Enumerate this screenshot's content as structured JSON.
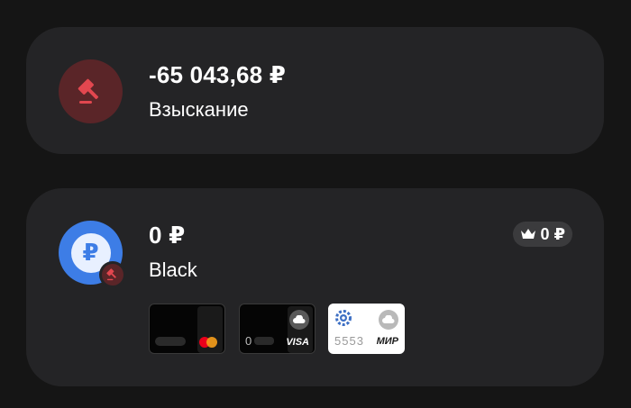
{
  "debt_card": {
    "amount": "-65 043,68 ₽",
    "label": "Взыскание",
    "icon": "gavel-icon",
    "icon_bg": "#5a2528",
    "icon_color": "#e2474f"
  },
  "account_card": {
    "amount": "0 ₽",
    "label": "Black",
    "icon": "ruble-icon",
    "icon_symbol": "₽",
    "icon_bg": "#3d7de6",
    "badge_icon": "gavel-icon",
    "bonus": {
      "icon": "crown-icon",
      "value": "0 ₽"
    },
    "cards": [
      {
        "name": "mastercard-card",
        "number": "",
        "brand": "mastercard-logo",
        "theme": "black"
      },
      {
        "name": "visa-card",
        "number": "0",
        "brand": "VISA",
        "theme": "black",
        "badge": "cloud-icon"
      },
      {
        "name": "mir-card",
        "number": "5553",
        "brand": "МИР",
        "theme": "white",
        "badge": "cloud-icon",
        "top_icon": "gear-icon"
      }
    ]
  }
}
